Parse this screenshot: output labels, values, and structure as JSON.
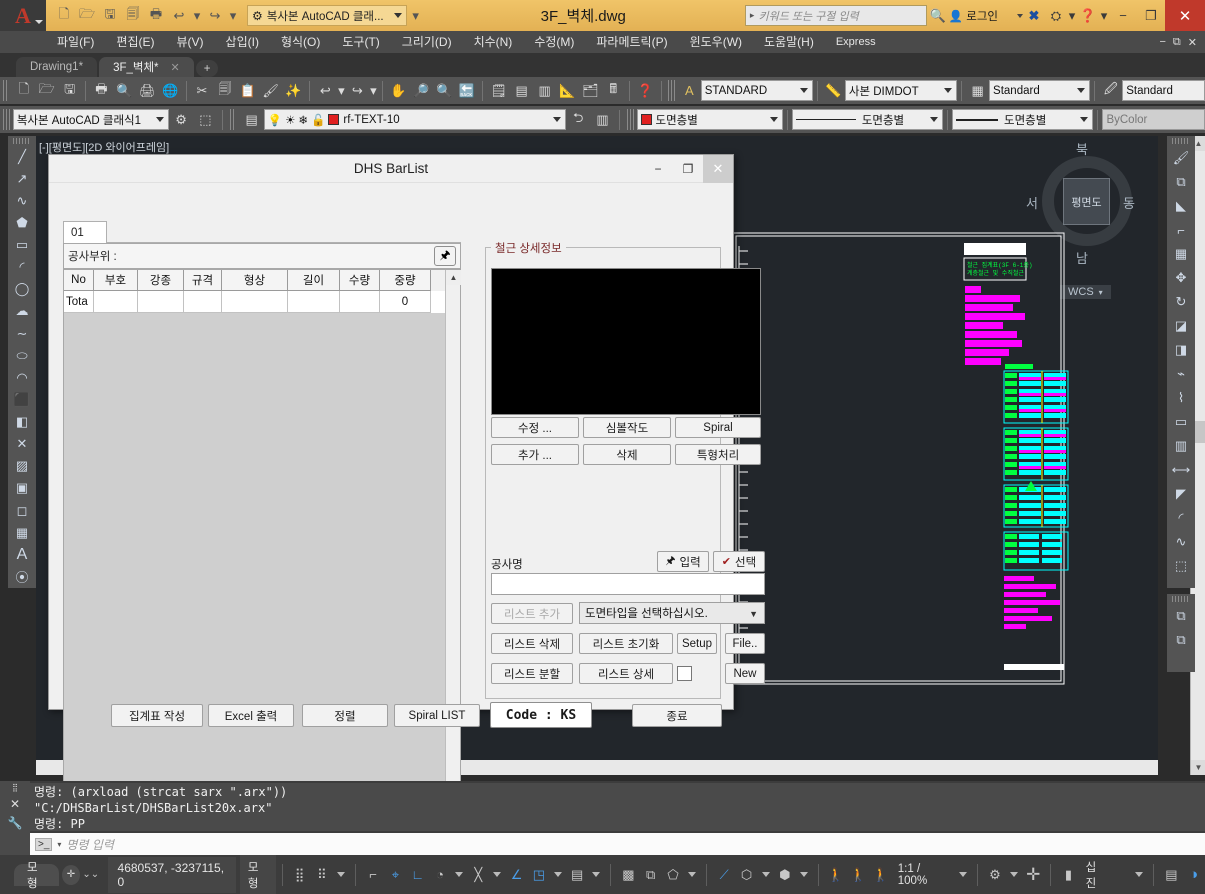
{
  "titlebar": {
    "app_logo": "A",
    "workspace": "복사본 AutoCAD 클래...",
    "document_title": "3F_벽체.dwg",
    "search_placeholder": "키워드 또는 구절 입력",
    "signin_label": "로그인",
    "quick_access": [
      {
        "name": "new-icon",
        "glyph": "🗋"
      },
      {
        "name": "open-icon",
        "glyph": "🗁"
      },
      {
        "name": "save-icon",
        "glyph": "🖫"
      },
      {
        "name": "saveas-icon",
        "glyph": "🗐"
      },
      {
        "name": "plot-icon",
        "glyph": "🖶"
      },
      {
        "name": "undo-icon",
        "glyph": "↩"
      },
      {
        "name": "redo-icon",
        "glyph": "↪"
      }
    ],
    "window_buttons": {
      "minimize": "−",
      "maximize": "❐",
      "close": "✕"
    }
  },
  "menubar": {
    "items": [
      {
        "label": "파일(F)"
      },
      {
        "label": "편집(E)"
      },
      {
        "label": "뷰(V)"
      },
      {
        "label": "삽입(I)"
      },
      {
        "label": "형식(O)"
      },
      {
        "label": "도구(T)"
      },
      {
        "label": "그리기(D)"
      },
      {
        "label": "치수(N)"
      },
      {
        "label": "수정(M)"
      },
      {
        "label": "파라메트릭(P)"
      },
      {
        "label": "윈도우(W)"
      },
      {
        "label": "도움말(H)"
      },
      {
        "label": "Express"
      }
    ],
    "right_buttons": {
      "minimize": "−",
      "restore": "⧉",
      "close": "✕"
    }
  },
  "doctabs": {
    "tabs": [
      {
        "label": "Drawing1*",
        "active": false
      },
      {
        "label": "3F_벽체*",
        "active": true
      }
    ],
    "new_tab": "+"
  },
  "toolbar_row2": {
    "workspace_value": "복사본 AutoCAD 클래식1",
    "layer_value": "rf-TEXT-10",
    "text_style_value": "STANDARD",
    "dim_style_value": "사본 DIMDOT",
    "table_style_value": "Standard",
    "mleader_style_value": "Standard"
  },
  "toolbar_row3": {
    "color_value": "도면층별",
    "linetype_value": "도면층별",
    "lineweight_value": "도면층별",
    "plotstyle_value": "ByColor",
    "color_hex": "#e02020"
  },
  "viewport": {
    "label": "[-][평면도][2D 와이어프레임]",
    "viewcube": {
      "north": "북",
      "south": "남",
      "east": "동",
      "west": "서",
      "face": "평면도",
      "ucs": "WCS"
    }
  },
  "dialog": {
    "title": "DHS BarList",
    "window_buttons": {
      "minimize": "−",
      "maximize": "❐",
      "close": "✕"
    },
    "tab_label": "01",
    "part_label": "공사부위 :",
    "grid": {
      "headers": [
        "No",
        "부호",
        "강종",
        "규격",
        "형상",
        "길이",
        "수량",
        "중량"
      ],
      "rows": [
        {
          "cells": [
            "Tota",
            "",
            "",
            "",
            "",
            "",
            "",
            "0"
          ]
        }
      ]
    },
    "detail_group_label": "철근 상세정보",
    "detail_buttons": [
      {
        "label": "수정 ...",
        "name": "edit-button"
      },
      {
        "label": "심볼작도",
        "name": "symbol-draw-button"
      },
      {
        "label": "Spiral",
        "name": "spiral-button"
      },
      {
        "label": "추가 ...",
        "name": "add-button"
      },
      {
        "label": "삭제",
        "name": "delete-button"
      },
      {
        "label": "특형처리",
        "name": "special-shape-button"
      }
    ],
    "project_name_label": "공사명",
    "project_name_value": "",
    "input_button": "입력",
    "select_button": "선택",
    "list_add_button": "리스트 추가",
    "drawing_type_value": "도면타입을 선택하십시오.",
    "list_delete_button": "리스트 삭제",
    "list_reset_button": "리스트 초기화",
    "setup_button": "Setup",
    "file_button": "File..",
    "list_split_button": "리스트 분할",
    "list_detail_button": "리스트 상세",
    "new_button": "New",
    "detail_checkbox_checked": false,
    "bottom_buttons": [
      {
        "label": "집계표 작성",
        "name": "make-summary-table-button"
      },
      {
        "label": "Excel 출력",
        "name": "excel-export-button"
      },
      {
        "label": "정렬",
        "name": "sort-button"
      },
      {
        "label": "Spiral LIST",
        "name": "spiral-list-button"
      }
    ],
    "code_label": "Code : KS",
    "exit_button": "종료"
  },
  "command_line": {
    "history": [
      "명령: (arxload (strcat sarx \".arx\"))",
      "\"C:/DHSBarList/DHSBarList20x.arx\"",
      "명령: PP"
    ],
    "placeholder": "명령 입력",
    "prompt": ">_"
  },
  "statusbar": {
    "model_tab": "모형",
    "coordinates": "4680537, -3237115, 0",
    "space_label": "모형",
    "scale_label": "1:1 / 100%",
    "units_label": "십진",
    "icons": [
      {
        "name": "grid-display-icon",
        "glyph": "▦"
      },
      {
        "name": "snap-mode-icon",
        "glyph": "⣿"
      },
      {
        "name": "ortho-mode-icon",
        "glyph": "⌐"
      },
      {
        "name": "polar-tracking-icon",
        "glyph": "∠"
      },
      {
        "name": "object-snap-icon",
        "glyph": "⌖"
      },
      {
        "name": "osnap-tracking-icon",
        "glyph": "∠"
      },
      {
        "name": "dynamic-ucs-icon",
        "glyph": "⬚"
      },
      {
        "name": "dynamic-input-icon",
        "glyph": "⊞"
      },
      {
        "name": "lineweight-icon",
        "glyph": "▤"
      },
      {
        "name": "transparency-icon",
        "glyph": "▩"
      },
      {
        "name": "selection-cycling-icon",
        "glyph": "⧉"
      },
      {
        "name": "annotation-monitor-icon",
        "glyph": "◳"
      },
      {
        "name": "workspace-switch-icon",
        "glyph": "⚙"
      },
      {
        "name": "customization-icon",
        "glyph": "▤"
      }
    ]
  }
}
